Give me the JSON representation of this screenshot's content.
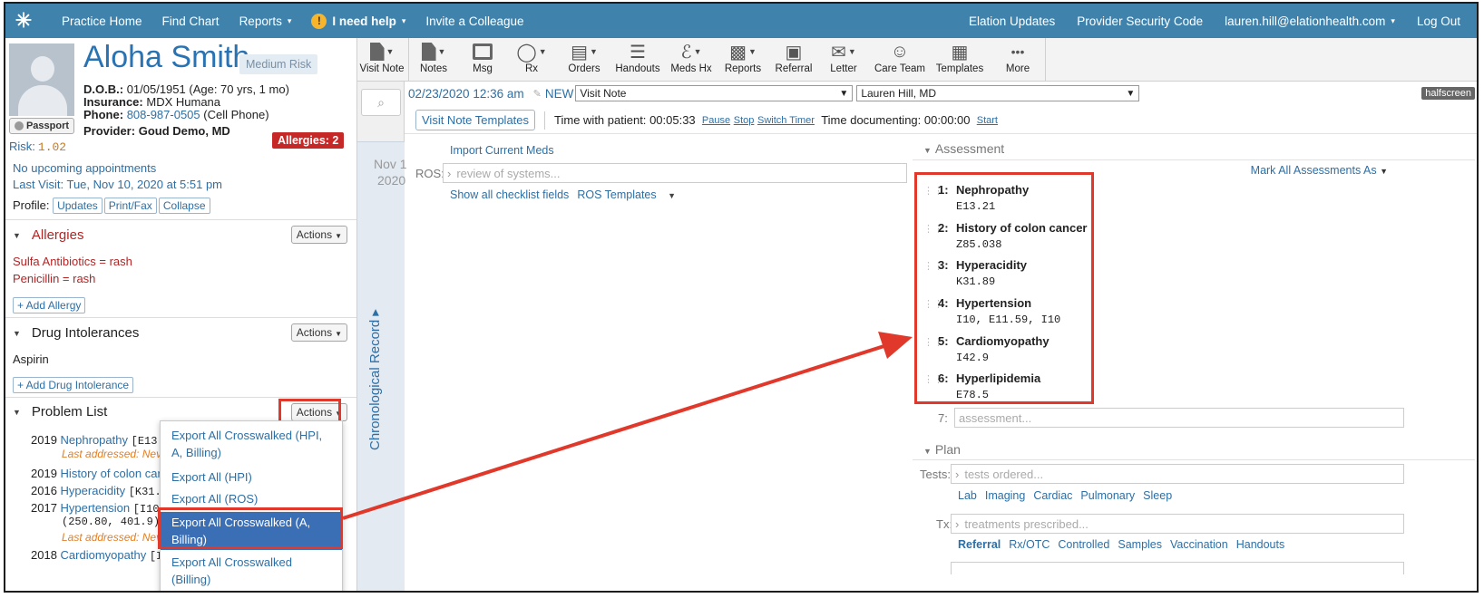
{
  "topnav": {
    "logo": "✳",
    "practice_home": "Practice Home",
    "find_chart": "Find Chart",
    "reports": "Reports",
    "help": "I need help",
    "help_icon": "!",
    "invite": "Invite a Colleague",
    "elation_updates": "Elation Updates",
    "security_code": "Provider Security Code",
    "user": "lauren.hill@elationhealth.com",
    "logout": "Log Out",
    "caret": "▾"
  },
  "patient": {
    "name": "Aloha Smith",
    "risk_badge": "Medium Risk",
    "passport": "Passport",
    "risk_label": "Risk:",
    "risk_value": "1.02",
    "dob_label": "D.O.B.:",
    "dob": "01/05/1951 (Age: 70 yrs, 1 mo)",
    "insurance_label": "Insurance:",
    "insurance": "MDX Humana",
    "phone_label": "Phone:",
    "phone": "808-987-0505",
    "phone_type": "(Cell Phone)",
    "provider_label": "Provider:",
    "provider": "Goud Demo, MD",
    "allergies_badge": "Allergies: 2",
    "upcoming": "No upcoming appointments",
    "last_visit": "Last Visit: Tue, Nov 10, 2020 at 5:51 pm",
    "profile_label": "Profile:",
    "profile_buttons": [
      "Updates",
      "Print/Fax",
      "Collapse"
    ]
  },
  "allergies": {
    "title": "Allergies",
    "actions": "Actions",
    "items": [
      "Sulfa Antibiotics = rash",
      "Penicillin = rash"
    ],
    "add": "+ Add Allergy"
  },
  "intolerances": {
    "title": "Drug Intolerances",
    "actions": "Actions",
    "items": [
      "Aspirin"
    ],
    "add": "+ Add Drug Intolerance"
  },
  "problems": {
    "title": "Problem List",
    "actions": "Actions",
    "items": [
      {
        "year": "2019",
        "name": "Nephropathy",
        "code": "[E13.",
        "last": "Last addressed: Neve"
      },
      {
        "year": "2019",
        "name": "History of colon car",
        "code": "",
        "last": ""
      },
      {
        "year": "2016",
        "name": "Hyperacidity",
        "code": "[K31.",
        "last": ""
      },
      {
        "year": "2017",
        "name": "Hypertension",
        "code": "[I10",
        "code2": "(250.80, 401.9)",
        "last": "Last addressed: Neve"
      },
      {
        "year": "2018",
        "name": "Cardiomyopathy",
        "code": "[I",
        "last": ""
      }
    ]
  },
  "actions_menu": [
    "Export All Crosswalked (HPI, A, Billing)",
    "Export All (HPI)",
    "Export All (ROS)",
    "Export All Crosswalked (A, Billing)",
    "Export All Crosswalked (Billing)"
  ],
  "toolbar": {
    "items": [
      "Visit Note",
      "Notes",
      "Msg",
      "Rx",
      "Orders",
      "Handouts",
      "Meds Hx",
      "Reports",
      "Referral",
      "Letter",
      "Care Team",
      "Templates",
      "More"
    ]
  },
  "timeline": {
    "search_icon": "⌕",
    "chrono_label": "Chronological Record",
    "chrono_caret": "▸",
    "date_month": "Nov 1",
    "date_year": "2020"
  },
  "note": {
    "datetime": "02/23/2020 12:36 am",
    "new": "NEW",
    "type": "Visit Note",
    "provider": "Lauren Hill, MD",
    "halfscreen": "halfscreen",
    "templates_btn": "Visit Note Templates",
    "time_with_patient_label": "Time with patient:",
    "time_with_patient": "00:05:33",
    "pause": "Pause",
    "stop": "Stop",
    "switch_timer": "Switch Timer",
    "time_documenting_label": "Time documenting:",
    "time_documenting": "00:00:00",
    "start": "Start",
    "import_meds": "Import Current Meds",
    "ros_label": "ROS:",
    "ros_placeholder": "review of systems...",
    "show_checklist": "Show all checklist fields",
    "ros_templates": "ROS Templates"
  },
  "assessment": {
    "title": "Assessment",
    "mark_all": "Mark All Assessments As",
    "items": [
      {
        "num": "1:",
        "name": "Nephropathy",
        "code": "E13.21"
      },
      {
        "num": "2:",
        "name": "History of colon cancer",
        "code": "Z85.038"
      },
      {
        "num": "3:",
        "name": "Hyperacidity",
        "code": "K31.89"
      },
      {
        "num": "4:",
        "name": "Hypertension",
        "code": "I10, E11.59, I10"
      },
      {
        "num": "5:",
        "name": "Cardiomyopathy",
        "code": "I42.9"
      },
      {
        "num": "6:",
        "name": "Hyperlipidemia",
        "code": "E78.5"
      }
    ],
    "next_num": "7:",
    "placeholder": "assessment..."
  },
  "plan": {
    "title": "Plan",
    "tests_label": "Tests:",
    "tests_placeholder": "tests ordered...",
    "tests_links": [
      "Lab",
      "Imaging",
      "Cardiac",
      "Pulmonary",
      "Sleep"
    ],
    "tx_label": "Tx:",
    "tx_placeholder": "treatments prescribed...",
    "tx_links": [
      "Referral",
      "Rx/OTC",
      "Controlled",
      "Samples",
      "Vaccination",
      "Handouts"
    ]
  },
  "colors": {
    "nav": "#3f83ad",
    "link": "#2d6fa5",
    "annotation": "#e0392b",
    "allergy": "#b42424"
  }
}
